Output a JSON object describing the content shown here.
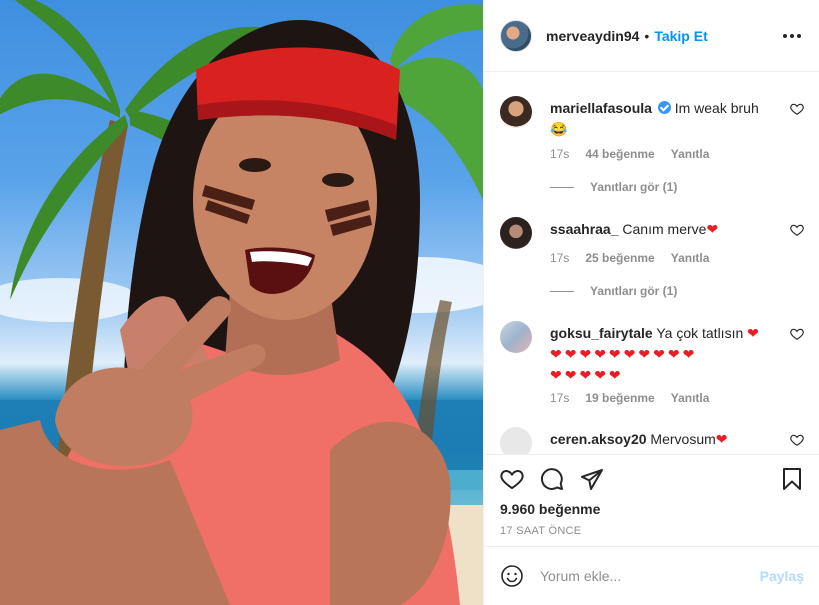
{
  "post": {
    "username": "merveaydin94",
    "separator": "•",
    "follow_label": "Takip Et",
    "more_icon": "more-options-icon"
  },
  "comments": [
    {
      "username": "mariellafasoula",
      "verified": true,
      "text": "Im weak bruh",
      "emoji": "😂",
      "time": "17s",
      "likes": "44 beğenme",
      "reply": "Yanıtla",
      "view_replies": "Yanıtları gör (1)"
    },
    {
      "username": "ssaahraa_",
      "text": "Canım merve",
      "emoji": "❤",
      "time": "17s",
      "likes": "25 beğenme",
      "reply": "Yanıtla",
      "view_replies": "Yanıtları gör (1)"
    },
    {
      "username": "goksu_fairytale",
      "text": "Ya çok tatlısın",
      "emoji": "❤",
      "hearts_line1": "❤❤❤❤❤❤❤❤❤❤",
      "hearts_line2": "❤❤❤❤❤",
      "time": "17s",
      "likes": "19 beğenme",
      "reply": "Yanıtla"
    },
    {
      "username": "ceren.aksoy20",
      "text": "Mervosum",
      "emoji": "❤"
    }
  ],
  "actions": {
    "like_icon": "heart-icon",
    "comment_icon": "comment-icon",
    "share_icon": "share-icon",
    "save_icon": "bookmark-icon",
    "likes_total": "9.960 beğenme",
    "time_ago": "17 SAAT ÖNCE"
  },
  "add_comment": {
    "placeholder": "Yorum ekle...",
    "post_label": "Paylaş",
    "emoji_icon": "smiley-icon"
  },
  "colors": {
    "link_blue": "#0095f6",
    "post_disabled": "#b3dbff",
    "verified": "#3897f0",
    "heart_red": "#ed1c24"
  }
}
